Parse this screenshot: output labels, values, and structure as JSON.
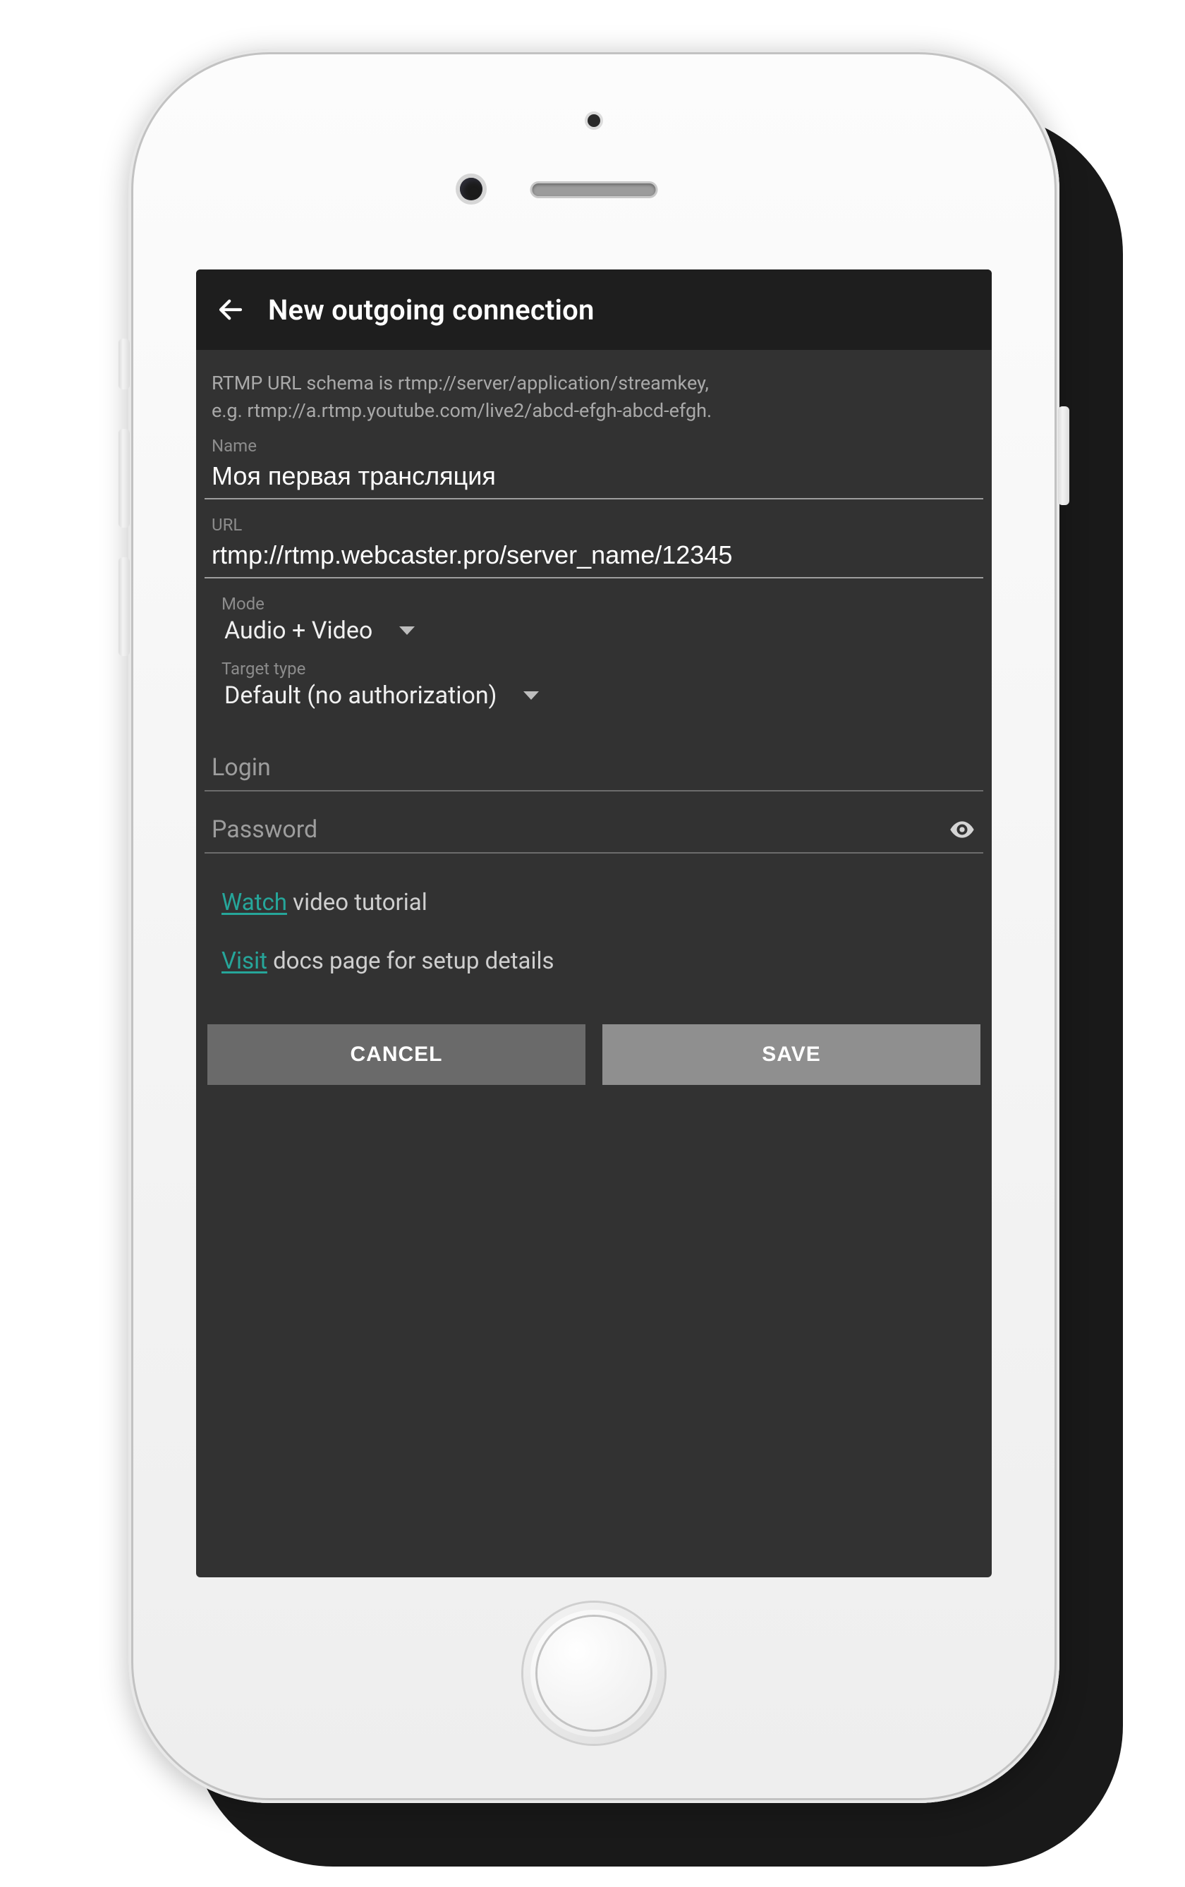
{
  "app": {
    "title": "New outgoing connection",
    "help_line1": "RTMP URL schema is rtmp://server/application/streamkey,",
    "help_line2": "e.g. rtmp://a.rtmp.youtube.com/live2/abcd-efgh-abcd-efgh."
  },
  "fields": {
    "name_label": "Name",
    "name_value": "Моя первая трансляция",
    "url_label": "URL",
    "url_value": "rtmp://rtmp.webcaster.pro/server_name/12345",
    "mode_label": "Mode",
    "mode_value": "Audio + Video",
    "target_label": "Target type",
    "target_value": "Default (no authorization)",
    "login_placeholder": "Login",
    "password_placeholder": "Password"
  },
  "links": {
    "watch_link": "Watch",
    "watch_rest": " video tutorial",
    "visit_link": "Visit",
    "visit_rest": " docs page for setup details"
  },
  "buttons": {
    "cancel": "CANCEL",
    "save": "SAVE"
  },
  "colors": {
    "accent": "#26a69a",
    "screen_bg": "#323232",
    "toolbar_bg": "#1e1e1e"
  }
}
